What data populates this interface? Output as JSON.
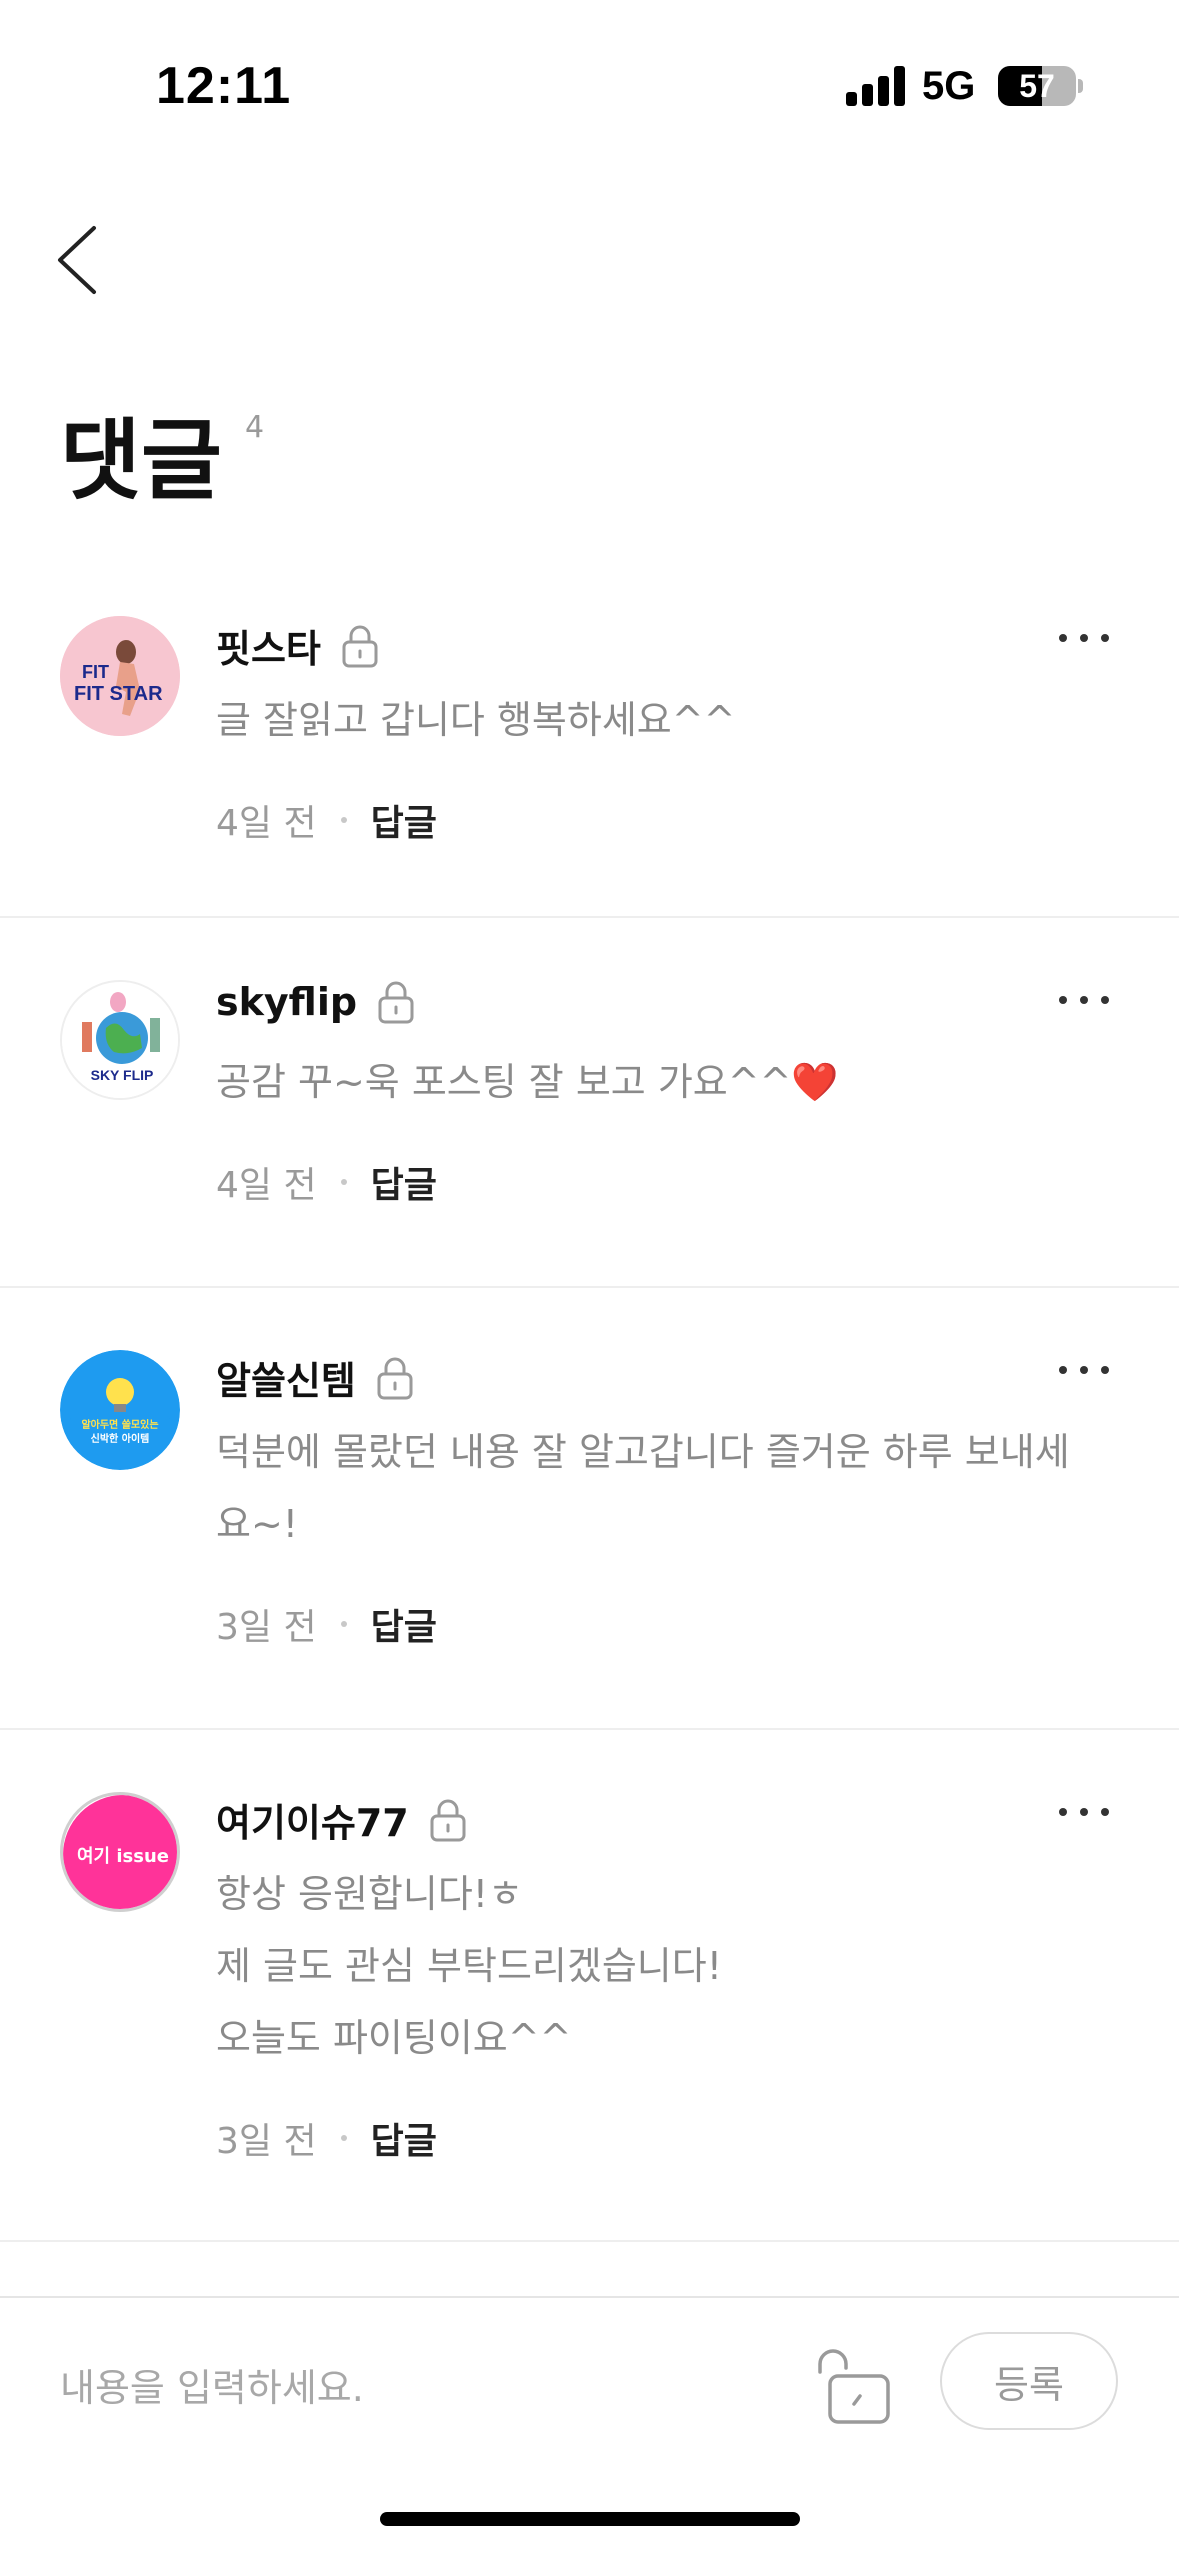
{
  "status_bar": {
    "time": "12:11",
    "network": "5G",
    "battery_level": "57",
    "battery_fraction": 0.57
  },
  "header": {
    "title": "댓글",
    "count": "4"
  },
  "comments": [
    {
      "name": "핏스타",
      "avatar_text": "FIT STAR",
      "avatar_bg": "#f7c6d0",
      "text_lines": [
        "글 잘읽고 갑니다 행복하세요^^"
      ],
      "date": "4일 전",
      "reply_label": "답글"
    },
    {
      "name": "skyflip",
      "avatar_text": "SKY FLIP",
      "avatar_bg": "#ffffff",
      "text_lines": [
        "공감 꾸~욱 포스팅 잘 보고 가요^^❤️"
      ],
      "date": "4일 전",
      "reply_label": "답글"
    },
    {
      "name": "알쓸신템",
      "avatar_text": "알아두면 쓸모있는 신박한 아이템",
      "avatar_bg": "#1e9bf0",
      "text_lines": [
        "덕분에 몰랐던 내용 잘 알고갑니다 즐거운 하루 보내세",
        "요~!"
      ],
      "date": "3일 전",
      "reply_label": "답글"
    },
    {
      "name": "여기이슈77",
      "avatar_text": "여기 issue",
      "avatar_bg": "#ff3399",
      "text_lines": [
        "항상 응원합니다!ㅎ",
        "제 글도 관심 부탁드리겠습니다!",
        "오늘도 파이팅이요^^"
      ],
      "date": "3일 전",
      "reply_label": "답글"
    }
  ],
  "input_bar": {
    "placeholder": "내용을 입력하세요.",
    "submit_label": "등록"
  }
}
